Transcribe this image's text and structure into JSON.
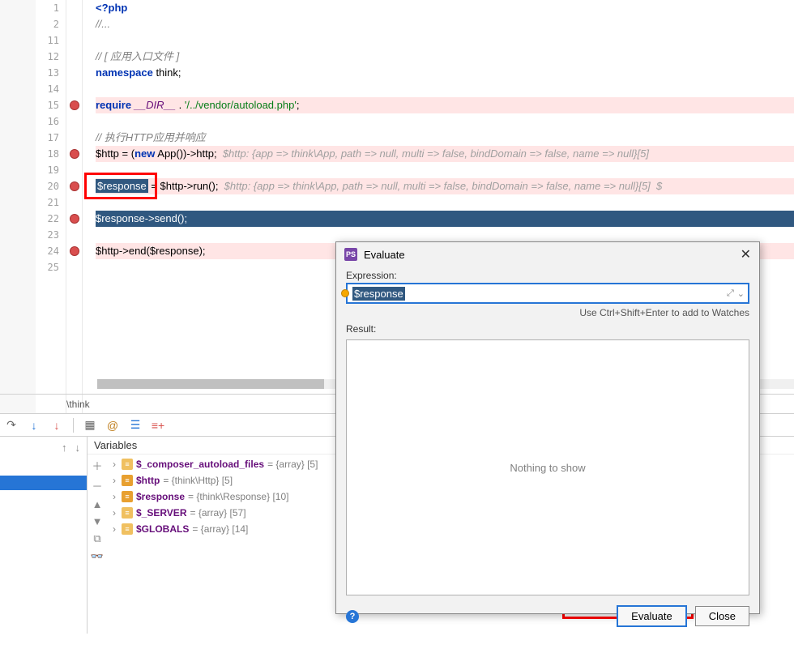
{
  "editor": {
    "line_numbers": [
      "1",
      "2",
      "11",
      "12",
      "13",
      "14",
      "15",
      "16",
      "17",
      "18",
      "19",
      "20",
      "21",
      "22",
      "23",
      "24",
      "25"
    ],
    "lines": {
      "php_open": "<?php",
      "dots": "//...",
      "cm_entry": "// [ 应用入口文件 ]",
      "ns_kw": "namespace",
      "ns_val": " think;",
      "req_kw": "require",
      "req_dir": "__DIR__",
      "req_dot": " . ",
      "req_str": "'/../vendor/autoload.php'",
      "req_semi": ";",
      "cm_run": "// 执行HTTP应用并响应",
      "http_var": "$http",
      "http_assign": " = (",
      "http_new": "new",
      "http_app": " App())->http;  ",
      "http_hint": "$http: {app => think\\App, path => null, multi => false, bindDomain => false, name => null}[5]",
      "resp_var": "$response",
      "resp_assign": " = $http->run();  ",
      "resp_hint": "$http: {app => think\\App, path => null, multi => false, bindDomain => false, name => null}[5]  $",
      "send": "$response->send();",
      "end": "$http->end($response);"
    },
    "breadcrumb": "\\think"
  },
  "variables": {
    "header": "Variables",
    "items": [
      {
        "name": "$_composer_autoload_files",
        "val": " = {array} [5]"
      },
      {
        "name": "$http",
        "val": " = {think\\Http} [5]"
      },
      {
        "name": "$response",
        "val": " = {think\\Response} [10]"
      },
      {
        "name": "$_SERVER",
        "val": " = {array} [57]"
      },
      {
        "name": "$GLOBALS",
        "val": " = {array} [14]"
      }
    ]
  },
  "dialog": {
    "title": "Evaluate",
    "expr_label": "Expression:",
    "expr_value": "$response",
    "hint": "Use Ctrl+Shift+Enter to add to Watches",
    "result_label": "Result:",
    "result_empty": "Nothing to show",
    "btn_eval": "Evaluate",
    "btn_close": "Close"
  }
}
